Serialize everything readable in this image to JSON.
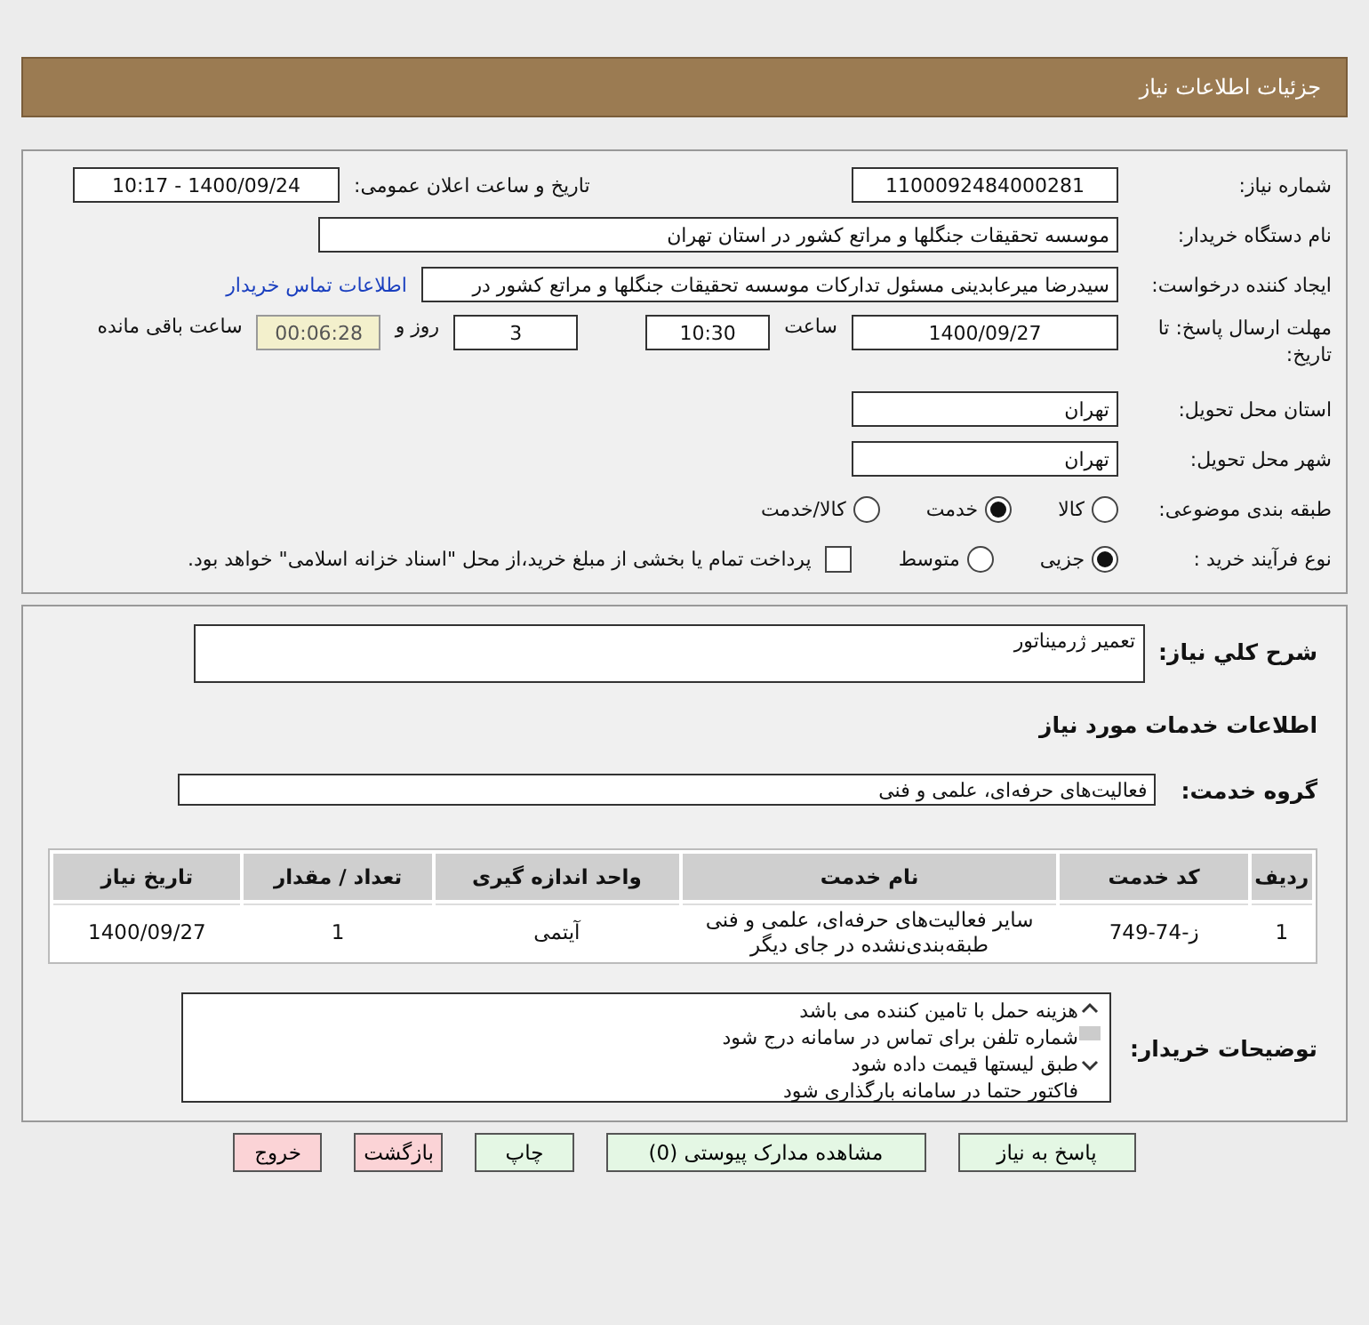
{
  "header": {
    "title": "جزئیات اطلاعات نیاز"
  },
  "details": {
    "need_number": {
      "label": "شماره نیاز:",
      "value": "1100092484000281"
    },
    "announce": {
      "label": "تاریخ و ساعت اعلان عمومی:",
      "value": "1400/09/24 - 10:17"
    },
    "buyer_org": {
      "label": "نام دستگاه خریدار:",
      "value": "موسسه تحقیقات جنگلها و مراتع کشور در استان تهران"
    },
    "requester": {
      "label": "ایجاد کننده درخواست:",
      "value": "سیدرضا میرعابدینی مسئول تدارکات موسسه تحقیقات جنگلها و مراتع کشور در",
      "link": "اطلاعات تماس خریدار"
    },
    "deadline": {
      "label": "مهلت ارسال پاسخ: تا تاریخ:",
      "date": "1400/09/27",
      "time_label": "ساعت",
      "time": "10:30",
      "days": "3",
      "days_label": "روز و",
      "remaining": "00:06:28",
      "remaining_label": "ساعت باقی مانده"
    },
    "province": {
      "label": "استان محل تحویل:",
      "value": "تهران"
    },
    "city": {
      "label": "شهر محل تحویل:",
      "value": "تهران"
    },
    "category": {
      "label": "طبقه بندی موضوعی:",
      "options": [
        {
          "label": "کالا",
          "selected": false
        },
        {
          "label": "خدمت",
          "selected": true
        },
        {
          "label": "کالا/خدمت",
          "selected": false
        }
      ]
    },
    "process": {
      "label": "نوع فرآیند خرید :",
      "options": [
        {
          "label": "جزیی",
          "selected": true
        },
        {
          "label": "متوسط",
          "selected": false
        }
      ],
      "payment": {
        "label": "پرداخت تمام یا بخشی از مبلغ خرید،از محل \"اسناد خزانه اسلامی\" خواهد بود.",
        "checked": false
      }
    }
  },
  "needs": {
    "summary": {
      "label": "شرح کلي نياز:",
      "value": "تعمیر ژرمیناتور"
    },
    "services_title": "اطلاعات خدمات مورد نیاز",
    "group": {
      "label": "گروه خدمت:",
      "value": "فعالیت‌های حرفه‌ای، علمی و فنی"
    },
    "table": {
      "columns": [
        "ردیف",
        "کد خدمت",
        "نام خدمت",
        "واحد اندازه گیری",
        "تعداد / مقدار",
        "تاریخ نیاز"
      ],
      "rows": [
        [
          "1",
          "ز-74-749",
          "سایر فعالیت‌های حرفه‌ای، علمی و فنی طبقه‌بندی‌نشده در جای دیگر",
          "آیتمی",
          "1",
          "1400/09/27"
        ]
      ]
    },
    "notes": {
      "label": "توضیحات خریدار:",
      "lines": [
        "هزینه حمل با تامین کننده می باشد",
        "شماره تلفن برای تماس در سامانه درج شود",
        "طبق لیستها قیمت داده شود",
        "فاکتور حتما در سامانه بارگذاری شود"
      ]
    }
  },
  "buttons": [
    {
      "label": "پاسخ به نیاز",
      "kind": "action"
    },
    {
      "label": "مشاهده مدارک پیوستی (0)",
      "kind": "action"
    },
    {
      "label": "چاپ",
      "kind": "action"
    },
    {
      "label": "بازگشت",
      "kind": "exit"
    },
    {
      "label": "خروج",
      "kind": "exit"
    }
  ]
}
